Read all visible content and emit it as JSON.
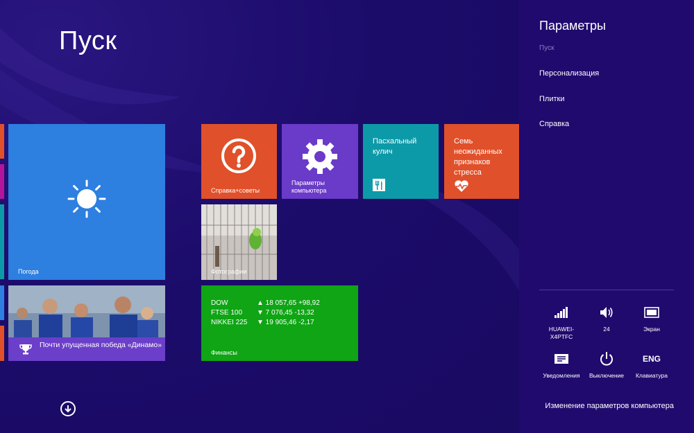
{
  "start": {
    "title": "Пуск",
    "tiles": {
      "weather": {
        "label": "Погода",
        "color": "#2d7fe0"
      },
      "help": {
        "label": "Справка+советы",
        "color": "#e0502a"
      },
      "pc_settings": {
        "label": "Параметры компьютера",
        "color": "#6a3ac8"
      },
      "easter_cake": {
        "text": "Пасхальный кулич",
        "color": "#0d9aa8"
      },
      "stress": {
        "text": "Семь неожиданных признаков стресса",
        "color": "#e0502a"
      },
      "photos": {
        "label": "Фотографии"
      },
      "news": {
        "text": "Почти упущенная победа «Динамо»"
      },
      "finance": {
        "label": "Финансы",
        "color": "#0fa514",
        "rows": [
          {
            "name": "DOW",
            "value": "▲ 18 057,65 +98,92"
          },
          {
            "name": "FTSE 100",
            "value": "▼ 7 076,45 -13,32"
          },
          {
            "name": "NIKKEI 225",
            "value": "▼ 19 905,46 -2,17"
          }
        ]
      }
    }
  },
  "panel": {
    "title": "Параметры",
    "items": [
      "Пуск",
      "Персонализация",
      "Плитки",
      "Справка"
    ],
    "quick_settings": [
      {
        "label": "HUAWEI-X4PTFC",
        "icon": "signal-icon"
      },
      {
        "label": "24",
        "icon": "volume-icon"
      },
      {
        "label": "Экран",
        "icon": "screen-icon"
      },
      {
        "label": "Уведомления",
        "icon": "notifications-icon"
      },
      {
        "label": "Выключение",
        "icon": "power-icon"
      },
      {
        "label": "Клавиатура",
        "icon": "keyboard-icon",
        "glyph": "ENG"
      }
    ],
    "change_settings": "Изменение параметров компьютера"
  }
}
